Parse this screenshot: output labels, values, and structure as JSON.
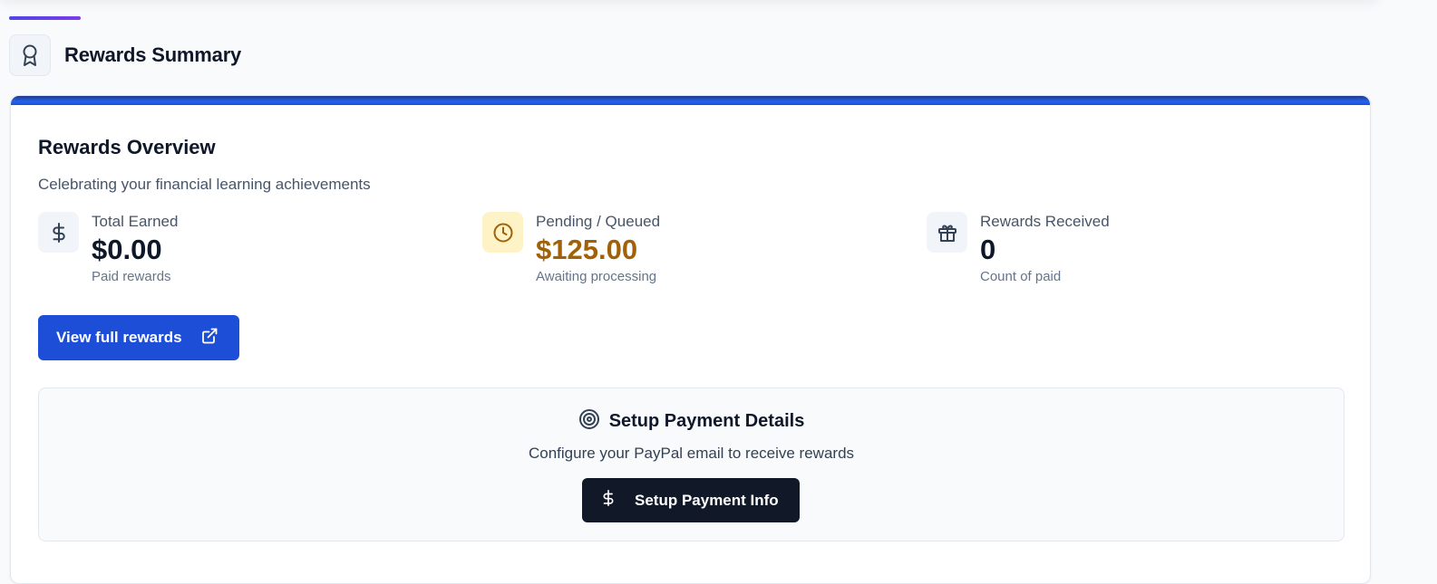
{
  "header": {
    "title": "Rewards Summary",
    "icon": "award-icon"
  },
  "overview": {
    "title": "Rewards Overview",
    "subtitle": "Celebrating your financial learning achievements"
  },
  "stats": [
    {
      "label": "Total Earned",
      "value": "$0.00",
      "caption": "Paid rewards",
      "icon": "dollar-icon"
    },
    {
      "label": "Pending / Queued",
      "value": "$125.00",
      "caption": "Awaiting processing",
      "icon": "clock-icon"
    },
    {
      "label": "Rewards Received",
      "value": "0",
      "caption": "Count of paid",
      "icon": "gift-icon"
    }
  ],
  "actions": {
    "view_full_rewards": "View full rewards"
  },
  "setup": {
    "title": "Setup Payment Details",
    "subtitle": "Configure your PayPal email to receive rewards",
    "button_label": "Setup Payment Info"
  },
  "colors": {
    "primary": "#1d4ed8",
    "pending": "#a16207",
    "pending_bg": "#fef3c7",
    "dark_button": "#111827"
  }
}
